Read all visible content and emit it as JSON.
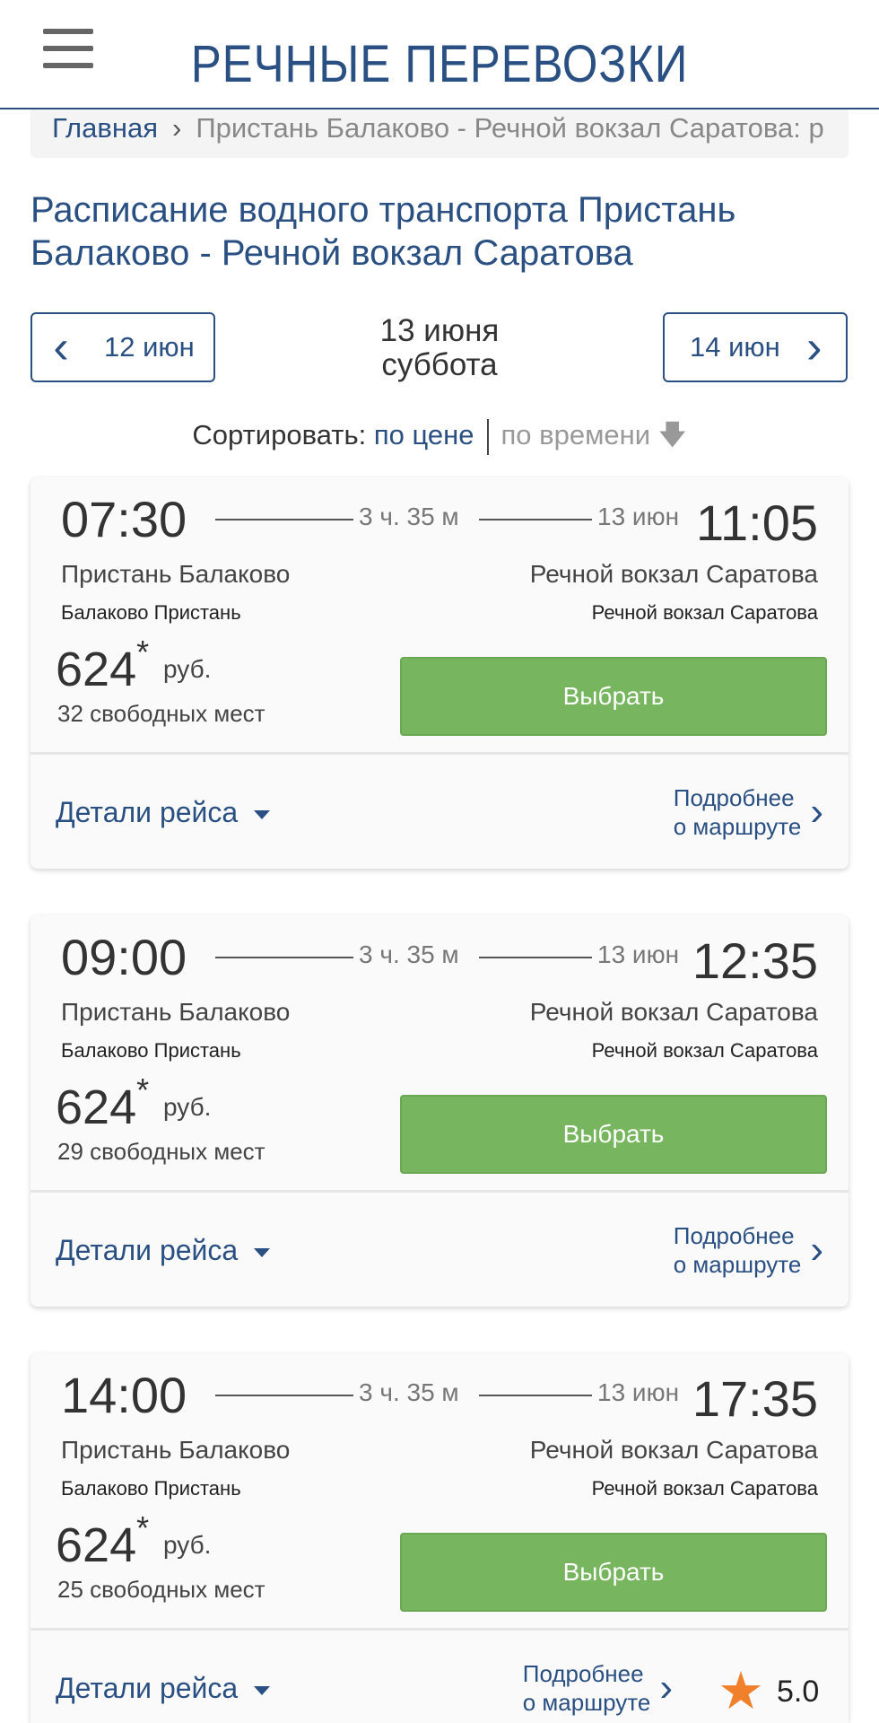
{
  "header": {
    "title": "РЕЧНЫЕ ПЕРЕВОЗКИ",
    "menu_icon": "hamburger-menu-icon"
  },
  "breadcrumb": {
    "home": "Главная",
    "separator": "›",
    "current": "Пристань Балаково - Речной вокзал Саратова: р"
  },
  "page_title": "Расписание водного транспорта Пристань Балаково - Речной вокзал Саратова",
  "date_nav": {
    "prev": "12 июн",
    "current_date": "13 июня",
    "current_weekday": "суббота",
    "next": "14 июн"
  },
  "sort": {
    "label": "Сортировать:",
    "by_price": "по цене",
    "by_time": "по времени"
  },
  "trips": [
    {
      "departure_time": "07:30",
      "arrival_time": "11:05",
      "duration": "3 ч. 35 м",
      "arrival_date": "13 июн",
      "departure_station": "Пристань Балаково",
      "arrival_station": "Речной вокзал Саратова",
      "departure_pier": "Балаково Пристань",
      "arrival_pier": "Речной вокзал Саратова",
      "price": "624",
      "price_mark": "*",
      "currency": "руб.",
      "seats": "32 свободных мест",
      "select_label": "Выбрать",
      "details_label": "Детали рейса",
      "more_line1": "Подробнее",
      "more_line2": "о маршруте"
    },
    {
      "departure_time": "09:00",
      "arrival_time": "12:35",
      "duration": "3 ч. 35 м",
      "arrival_date": "13 июн",
      "departure_station": "Пристань Балаково",
      "arrival_station": "Речной вокзал Саратова",
      "departure_pier": "Балаково Пристань",
      "arrival_pier": "Речной вокзал Саратова",
      "price": "624",
      "price_mark": "*",
      "currency": "руб.",
      "seats": "29 свободных мест",
      "select_label": "Выбрать",
      "details_label": "Детали рейса",
      "more_line1": "Подробнее",
      "more_line2": "о маршруте"
    },
    {
      "departure_time": "14:00",
      "arrival_time": "17:35",
      "duration": "3 ч. 35 м",
      "arrival_date": "13 июн",
      "departure_station": "Пристань Балаково",
      "arrival_station": "Речной вокзал Саратова",
      "departure_pier": "Балаково Пристань",
      "arrival_pier": "Речной вокзал Саратова",
      "price": "624",
      "price_mark": "*",
      "currency": "руб.",
      "seats": "25 свободных мест",
      "select_label": "Выбрать",
      "details_label": "Детали рейса",
      "more_line1": "Подробнее",
      "more_line2": "о маршруте"
    }
  ],
  "rating": {
    "value": "5.0",
    "icon": "star-icon"
  },
  "colors": {
    "brand_blue": "#2a5083",
    "select_green": "#77b65f",
    "star_orange": "#f0802b"
  }
}
